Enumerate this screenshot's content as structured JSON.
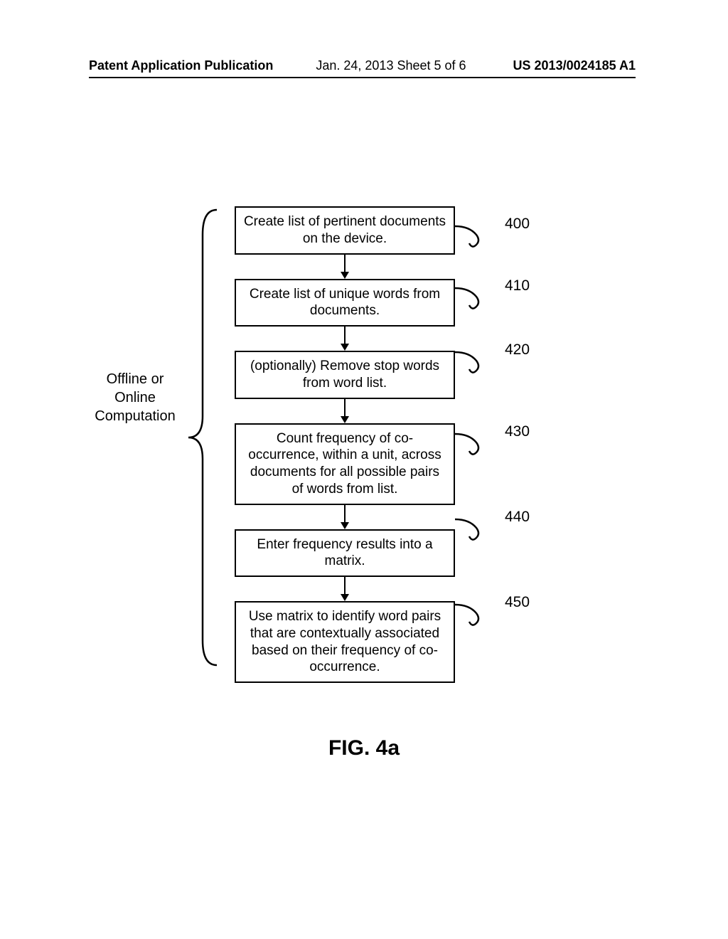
{
  "header": {
    "left": "Patent Application Publication",
    "mid": "Jan. 24, 2013  Sheet 5 of 6",
    "right": "US 2013/0024185 A1"
  },
  "brace_label": "Offline or Online Computation",
  "steps": [
    {
      "text": "Create list of pertinent documents on the device.",
      "ref": "400"
    },
    {
      "text": "Create list of unique words from documents.",
      "ref": "410"
    },
    {
      "text": "(optionally) Remove stop words from word list.",
      "ref": "420"
    },
    {
      "text": "Count frequency of co-occurrence, within a unit, across documents for all possible pairs of words from list.",
      "ref": "430"
    },
    {
      "text": "Enter frequency results into a matrix.",
      "ref": "440"
    },
    {
      "text": "Use matrix to identify word pairs that are contextually associated based on their frequency of co-occurrence.",
      "ref": "450"
    }
  ],
  "figure_label": "FIG. 4a"
}
